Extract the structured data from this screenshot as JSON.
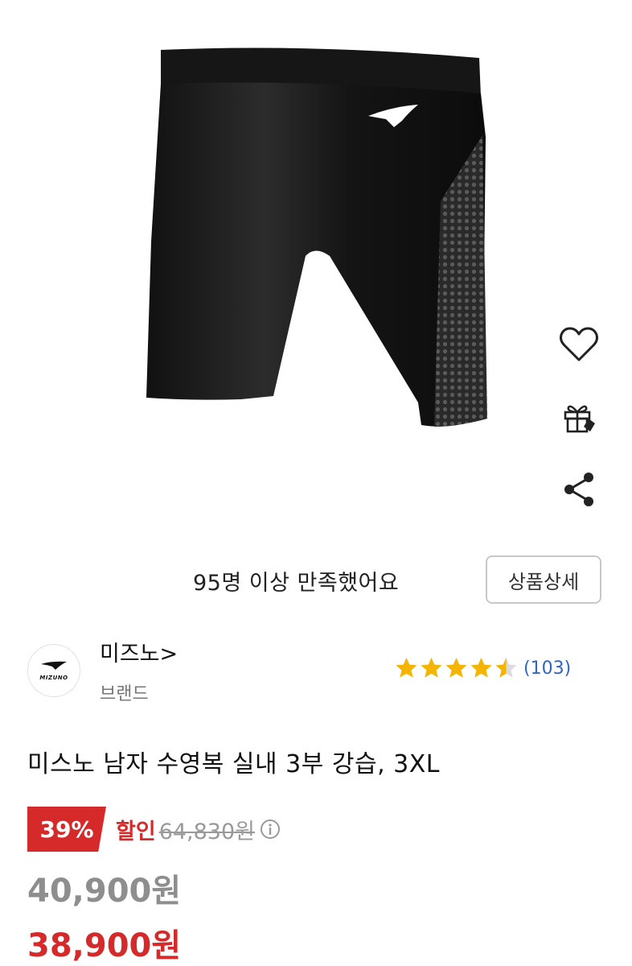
{
  "product": {
    "satisfaction_text": "95명 이상 만족했어요",
    "detail_button": "상품상세",
    "title": "미스노 남자 수영복 실내 3부 강습, 3XL"
  },
  "actions": {
    "icons": [
      "heart-icon",
      "gift-icon",
      "share-icon"
    ]
  },
  "brand": {
    "name": "미즈노>",
    "subtitle": "브랜드",
    "logo_text": "MIZUNO"
  },
  "rating": {
    "stars": 4.5,
    "review_count": "(103)"
  },
  "price": {
    "discount_percent": "39%",
    "discount_label": "할인",
    "original": "64,830원",
    "price_1": "40,900원",
    "price_2": "38,900원"
  },
  "colors": {
    "accent_red": "#d62a2a",
    "star_yellow": "#f4b400",
    "link_blue": "#2f64c9"
  }
}
